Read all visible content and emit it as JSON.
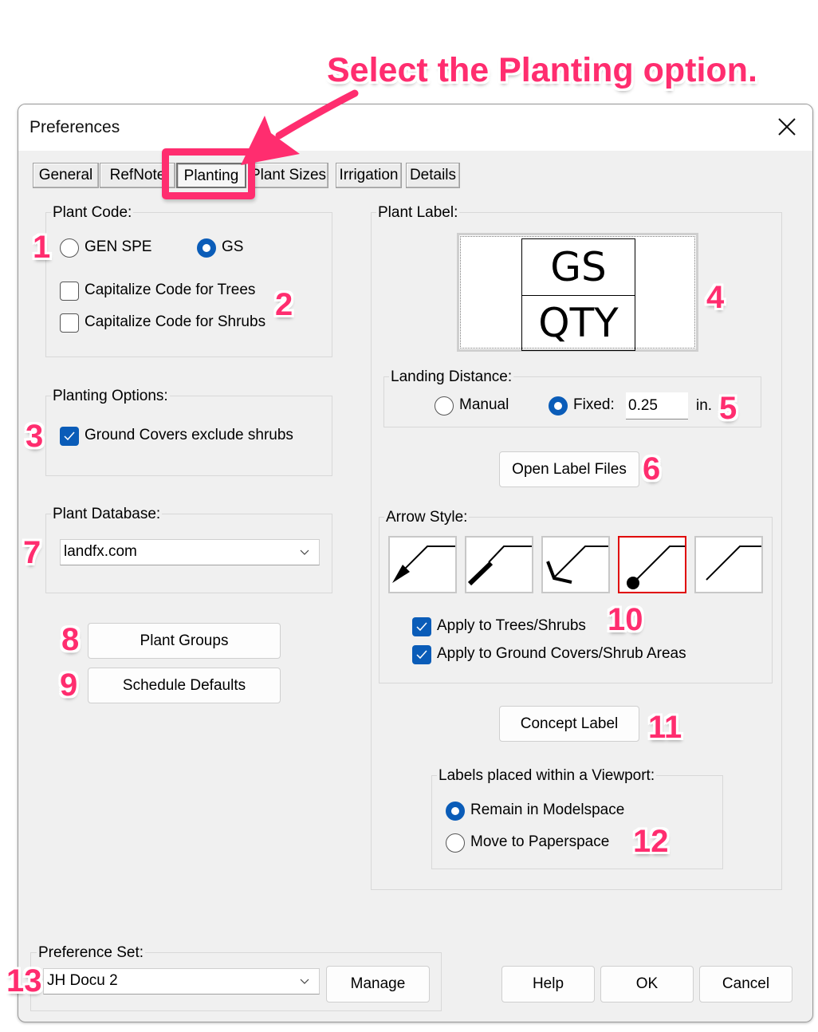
{
  "annotation": {
    "callout_text": "Select the Planting option.",
    "accent_color": "#ff2d6f",
    "step_numbers": [
      "1",
      "2",
      "3",
      "4",
      "5",
      "6",
      "7",
      "8",
      "9",
      "10",
      "11",
      "12",
      "13"
    ]
  },
  "window": {
    "title": "Preferences",
    "close_icon": "close-icon"
  },
  "tabs": [
    {
      "label": "General",
      "active": false
    },
    {
      "label": "RefNote",
      "active": false
    },
    {
      "label": "Planting",
      "active": true
    },
    {
      "label": "Plant Sizes",
      "active": false
    },
    {
      "label": "Irrigation",
      "active": false
    },
    {
      "label": "Details",
      "active": false
    }
  ],
  "plant_code": {
    "label": "Plant Code:",
    "options": [
      {
        "label": "GEN SPE",
        "selected": false
      },
      {
        "label": "GS",
        "selected": true
      }
    ],
    "checkboxes": [
      {
        "label": "Capitalize Code for Trees",
        "checked": false
      },
      {
        "label": "Capitalize Code for Shrubs",
        "checked": false
      }
    ]
  },
  "planting_options": {
    "label": "Planting Options:",
    "checkboxes": [
      {
        "label": "Ground Covers exclude shrubs",
        "checked": true
      }
    ]
  },
  "plant_database": {
    "label": "Plant Database:",
    "selected": "landfx.com"
  },
  "buttons_left": {
    "plant_groups": "Plant Groups",
    "schedule_defaults": "Schedule Defaults"
  },
  "plant_label": {
    "label": "Plant Label:",
    "preview_top": "GS",
    "preview_bottom": "QTY"
  },
  "landing_distance": {
    "label": "Landing Distance:",
    "options": [
      {
        "label": "Manual",
        "selected": false
      },
      {
        "label": "Fixed:",
        "selected": true
      }
    ],
    "value": "0.25",
    "unit": "in."
  },
  "open_label_files": "Open Label Files",
  "arrow_style": {
    "label": "Arrow Style:",
    "styles": [
      {
        "name": "arrowhead-filled",
        "selected": false
      },
      {
        "name": "thick-tail",
        "selected": false
      },
      {
        "name": "open-arrowhead",
        "selected": false
      },
      {
        "name": "dot",
        "selected": true
      },
      {
        "name": "plain-line",
        "selected": false
      }
    ],
    "selected_color": "#e00000",
    "checkboxes": [
      {
        "label": "Apply to Trees/Shrubs",
        "checked": true
      },
      {
        "label": "Apply to Ground Covers/Shrub Areas",
        "checked": true
      }
    ]
  },
  "concept_label": "Concept Label",
  "viewport": {
    "label": "Labels placed within a Viewport:",
    "options": [
      {
        "label": "Remain in Modelspace",
        "selected": true
      },
      {
        "label": "Move to Paperspace",
        "selected": false
      }
    ]
  },
  "preference_set": {
    "label": "Preference Set:",
    "selected": "JH Docu 2",
    "manage": "Manage"
  },
  "footer": {
    "help": "Help",
    "ok": "OK",
    "cancel": "Cancel"
  },
  "colors": {
    "control_blue": "#0a5cb8",
    "dialog_bg": "#f0f0f0"
  }
}
